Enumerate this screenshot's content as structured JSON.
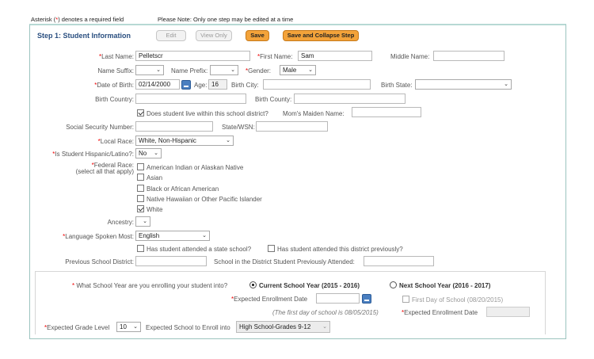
{
  "notice": {
    "prefix": "Asterisk (",
    "star": "*",
    "suffix": ") denotes a required field",
    "note": "Please Note: Only one step may be edited at a time"
  },
  "step": {
    "title": "Step 1: Student Information",
    "edit": "Edit",
    "view_only": "View Only",
    "save": "Save",
    "save_collapse": "Save and Collapse Step"
  },
  "star": "*",
  "fields": {
    "last_name": {
      "label": "Last Name:",
      "value": "Pelletscr"
    },
    "first_name": {
      "label": "First Name:",
      "value": "Sam"
    },
    "middle_name": {
      "label": "Middle Name:",
      "value": ""
    },
    "name_suffix": {
      "label": "Name Suffix:",
      "value": ""
    },
    "name_prefix": {
      "label": "Name Prefix:",
      "value": ""
    },
    "gender": {
      "label": "Gender:",
      "value": "Male"
    },
    "dob": {
      "label": "Date of Birth:",
      "value": "02/14/2000"
    },
    "age": {
      "label": "Age:",
      "value": "16"
    },
    "birth_city": {
      "label": "Birth City:",
      "value": ""
    },
    "birth_state": {
      "label": "Birth State:",
      "value": ""
    },
    "birth_country": {
      "label": "Birth Country:",
      "value": ""
    },
    "birth_county": {
      "label": "Birth County:",
      "value": ""
    },
    "lives_in_district": {
      "label": "Does student live within this school district?",
      "checked": true
    },
    "maiden_name": {
      "label": "Mom's Maiden Name:",
      "value": ""
    },
    "ssn": {
      "label": "Social Security Number:",
      "value": ""
    },
    "state_wsn": {
      "label": "State/WSN:",
      "value": ""
    },
    "local_race": {
      "label": "Local Race:",
      "value": "White, Non-Hispanic"
    },
    "hispanic": {
      "label": "Is Student Hispanic/Latino?:",
      "value": "No"
    },
    "federal_race": {
      "label": "Federal Race:",
      "sublabel": "(select all that apply)",
      "options": [
        {
          "label": "American Indian or Alaskan Native",
          "checked": false
        },
        {
          "label": "Asian",
          "checked": false
        },
        {
          "label": "Black or African American",
          "checked": false
        },
        {
          "label": "Native Hawaiian or Other Pacific Islander",
          "checked": false
        },
        {
          "label": "White",
          "checked": true
        }
      ]
    },
    "ancestry": {
      "label": "Ancestry:",
      "value": ""
    },
    "language": {
      "label": "Language Spoken Most:",
      "value": "English"
    },
    "attended_state": {
      "label": "Has student attended a state school?",
      "checked": false
    },
    "attended_district": {
      "label": "Has student attended this district previously?",
      "checked": false
    },
    "prev_district": {
      "label": "Previous School District:",
      "value": ""
    },
    "prev_school": {
      "label": "School in the District Student Previously Attended:",
      "value": ""
    }
  },
  "enrollment": {
    "question": "What School Year are you enrolling your student into?",
    "current_year": "Current School Year (2015 - 2016)",
    "next_year": "Next School Year (2016 - 2017)",
    "expected_date_label": "Expected Enrollment Date",
    "expected_date_value": "",
    "first_day_note": "(The first day of school is 08/05/2015)",
    "first_day_next": "First Day of School (08/20/2015)",
    "expected_date_next_label": "Expected Enrollment Date",
    "grade_label": "Expected Grade Level",
    "grade_value": "10",
    "school_label": "Expected School to Enroll into",
    "school_value": "High School-Grades 9-12"
  }
}
